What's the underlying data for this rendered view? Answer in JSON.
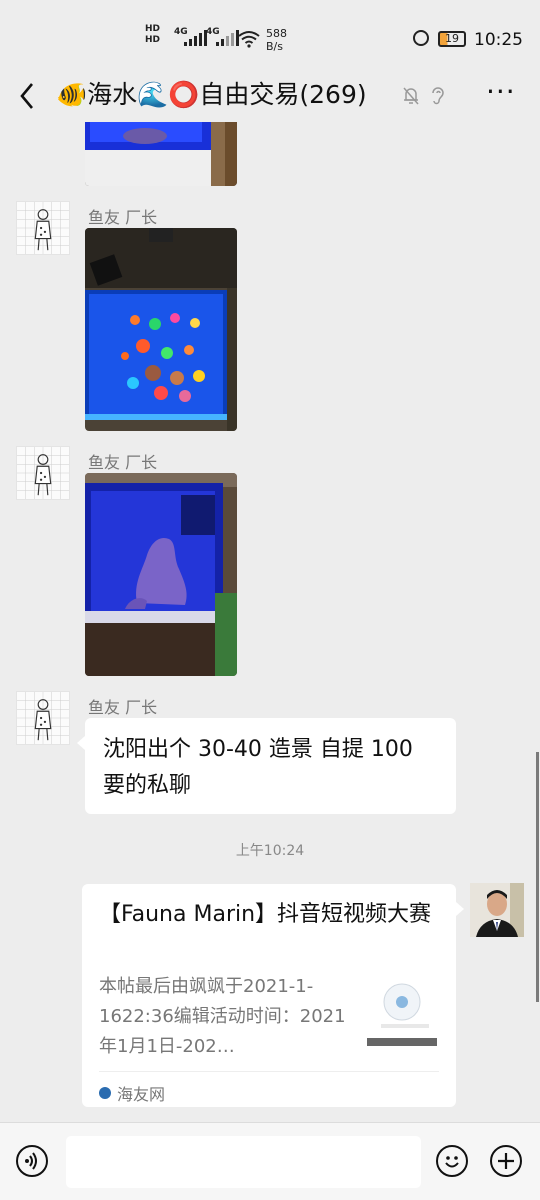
{
  "status_bar": {
    "net1": "HD",
    "net2": "HD",
    "sig1": "4G",
    "sig2": "4G",
    "speed_value": "588",
    "speed_unit": "B/s",
    "battery": "19",
    "time": "10:25"
  },
  "header": {
    "back_icon": "chevron-left-icon",
    "title": "🐠海水🌊⭕自由交易(269)",
    "mute_icon": "bell-off-icon",
    "ear_icon": "ear-icon",
    "more_icon": "more-icon",
    "more_label": "···"
  },
  "messages": [
    {
      "type": "image",
      "sender": "",
      "desc": "aquarium-partial"
    },
    {
      "type": "image",
      "sender": "鱼友 厂长",
      "desc": "reef-aquarium"
    },
    {
      "type": "image",
      "sender": "鱼友 厂长",
      "desc": "aquarium-rock"
    },
    {
      "type": "text",
      "sender": "鱼友 厂长",
      "text": "沈阳出个 30-40 造景 自提 100 要的私聊"
    },
    {
      "type": "time",
      "text": "上午10:24"
    },
    {
      "type": "link_card",
      "title": "【Fauna Marin】抖音短视频大赛",
      "desc": "本帖最后由飒飒于2021-1-1622:36编辑活动时间：2021年1月1日-202…",
      "source": "海友网"
    }
  ],
  "input_bar": {
    "voice_icon": "voice-icon",
    "placeholder": "",
    "emoji_icon": "emoji-icon",
    "plus_icon": "plus-icon"
  }
}
